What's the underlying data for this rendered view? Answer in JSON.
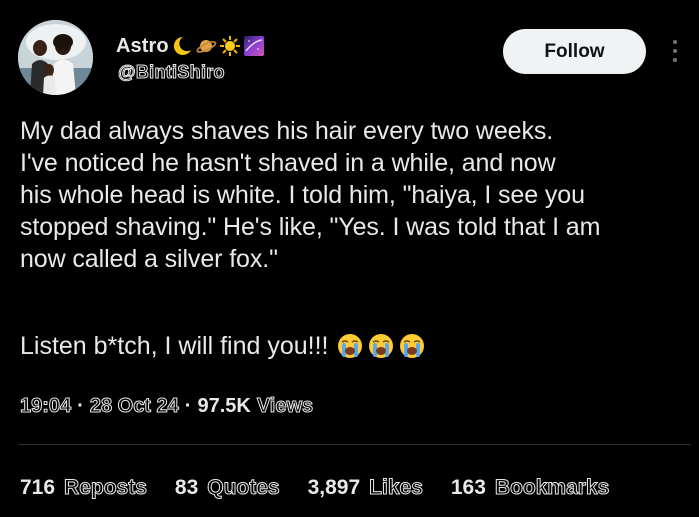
{
  "author": {
    "display_name": "Astro",
    "name_emojis": [
      "crescent-moon-emoji",
      "ringed-planet-emoji",
      "sun-emoji",
      "galaxy-emoji"
    ],
    "handle": "@BintiShiro"
  },
  "actions": {
    "follow_label": "Follow"
  },
  "tweet": {
    "paragraph1": "My dad always shaves his hair every two weeks.\nI've noticed he hasn't shaved in a while, and now\nhis whole head is white. I told him, \"haiya, I see you\nstopped shaving.\" He's like, \"Yes. I was told that I am\nnow called a silver fox.\"",
    "paragraph2": "Listen b*tch, I will find you!!!",
    "trailing_emojis": [
      "loudly-crying-face-emoji",
      "loudly-crying-face-emoji",
      "loudly-crying-face-emoji"
    ]
  },
  "meta": {
    "time": "19:04",
    "separator": "·",
    "date": "28 Oct 24",
    "views_count": "97.5K",
    "views_label": "Views"
  },
  "stats": {
    "reposts": {
      "count": "716",
      "label": "Reposts"
    },
    "quotes": {
      "count": "83",
      "label": "Quotes"
    },
    "likes": {
      "count": "3,897",
      "label": "Likes"
    },
    "bookmarks": {
      "count": "163",
      "label": "Bookmarks"
    }
  },
  "colors": {
    "background": "#000000",
    "text": "#e7e9ea",
    "follow_bg": "#eff3f4",
    "divider": "#2f3336"
  }
}
